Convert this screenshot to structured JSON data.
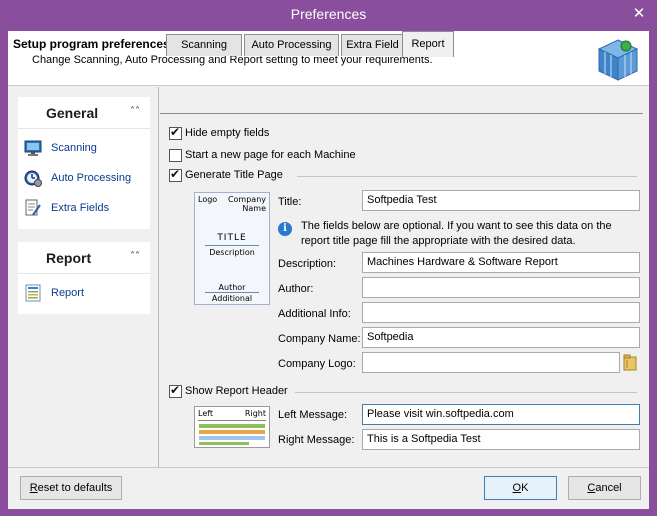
{
  "window": {
    "title": "Preferences",
    "close_glyph": "✕"
  },
  "header": {
    "title": "Setup program preferences",
    "subtitle": "Change Scanning, Auto Processing and Report setting to meet your requirements.",
    "logo_icon": "cube-grid-icon"
  },
  "sidebar": {
    "general": {
      "title": "General",
      "chevron": "˄˄",
      "items": [
        {
          "label": "Scanning",
          "icon": "monitor-icon"
        },
        {
          "label": "Auto Processing",
          "icon": "clock-gear-icon"
        },
        {
          "label": "Extra Fields",
          "icon": "document-pencil-icon"
        }
      ]
    },
    "report": {
      "title": "Report",
      "chevron": "˄˄",
      "items": [
        {
          "label": "Report",
          "icon": "report-sheet-icon"
        }
      ]
    }
  },
  "tabs": [
    {
      "label": "Scanning",
      "active": false
    },
    {
      "label": "Auto Processing",
      "active": false
    },
    {
      "label": "Extra Field",
      "active": false
    },
    {
      "label": "Report",
      "active": true
    }
  ],
  "report": {
    "hide_empty": {
      "label": "Hide empty fields",
      "checked": true
    },
    "new_page": {
      "label": "Start a new page for each Machine",
      "checked": false
    },
    "title_page": {
      "label": "Generate Title Page",
      "checked": true,
      "preview": {
        "logo": "Logo",
        "company_name": "Company\nName",
        "title": "TITLE",
        "description": "Description",
        "author": "Author",
        "additional": "Additional"
      },
      "title_label": "Title:",
      "title_value": "Softpedia Test",
      "info_text": "The fields below are optional. If you want to see this data on the report title page fill the appropriate with the desired data.",
      "fields": [
        {
          "label": "Description:",
          "value": "Machines Hardware & Software Report"
        },
        {
          "label": "Author:",
          "value": ""
        },
        {
          "label": "Additional Info:",
          "value": ""
        },
        {
          "label": "Company Name:",
          "value": "Softpedia"
        },
        {
          "label": "Company Logo:",
          "value": ""
        }
      ]
    },
    "report_header": {
      "label": "Show Report Header",
      "checked": true,
      "preview": {
        "left": "Left",
        "right": "Right"
      },
      "fields": [
        {
          "label": "Left Message:",
          "value": "Please visit win.softpedia.com"
        },
        {
          "label": "Right Message:",
          "value": "This is a Softpedia Test"
        }
      ]
    }
  },
  "buttons": {
    "reset": {
      "mnemonic": "R",
      "rest": "eset to defaults"
    },
    "ok": {
      "mnemonic": "O",
      "rest": "K"
    },
    "cancel": {
      "mnemonic": "C",
      "rest": "ancel"
    }
  },
  "colors": {
    "window_frame": "#8a4f9c",
    "link_text": "#0b3a8f",
    "info_icon": "#2a7ad0",
    "focus_border": "#3c7fb1"
  }
}
